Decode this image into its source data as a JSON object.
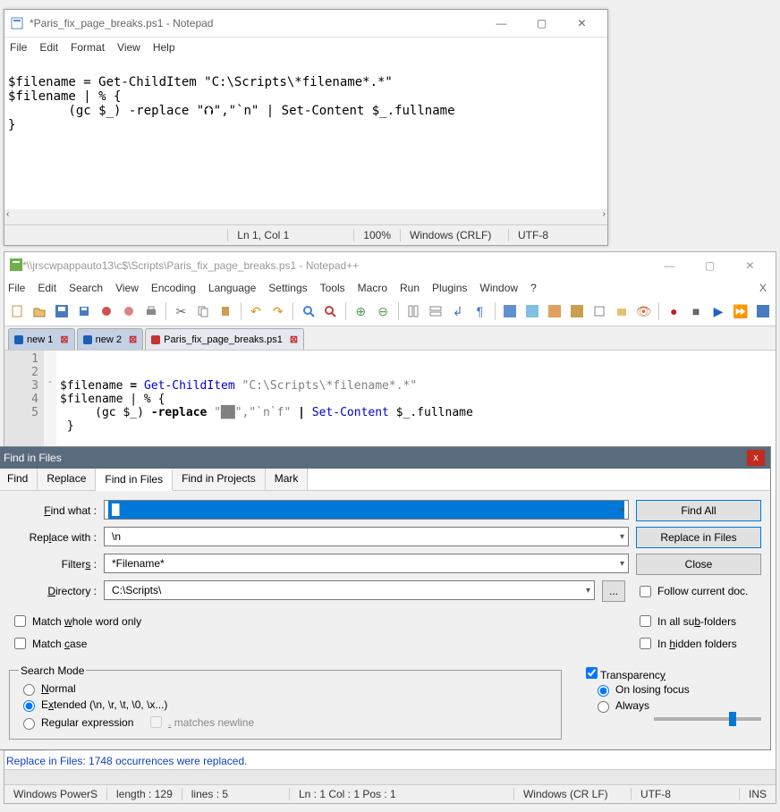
{
  "notepad": {
    "title": "*Paris_fix_page_breaks.ps1 - Notepad",
    "menu": [
      "File",
      "Edit",
      "Format",
      "View",
      "Help"
    ],
    "content": "\n$filename = Get-ChildItem \"C:\\Scripts\\*filename*.*\"\n$filename | % {\n        (gc $_) -replace \"⮉\",\"`n\" | Set-Content $_.fullname\n}",
    "status": {
      "lncol": "Ln 1, Col 1",
      "zoom": "100%",
      "eol": "Windows (CRLF)",
      "enc": "UTF-8"
    }
  },
  "npp": {
    "title": "*\\\\jrscwpappauto13\\c$\\Scripts\\Paris_fix_page_breaks.ps1 - Notepad++",
    "menu": [
      "File",
      "Edit",
      "Search",
      "View",
      "Encoding",
      "Language",
      "Settings",
      "Tools",
      "Macro",
      "Run",
      "Plugins",
      "Window",
      "?"
    ],
    "tabs": [
      {
        "label": "new 1",
        "modified": false
      },
      {
        "label": "new 2",
        "modified": false
      },
      {
        "label": "Paris_fix_page_breaks.ps1",
        "modified": true
      }
    ],
    "gutter": "1\n2\n3\n4\n5",
    "fold": " \n \n-\n \n ",
    "code": {
      "l1": "",
      "l2_pre": "$filename ",
      "l2_eq": "= ",
      "l2_cmd": "Get-ChildItem",
      "l2_str": " \"C:\\Scripts\\*filename*.*\"",
      "l3": "$filename | % {",
      "l4_pre": "     (gc $_) ",
      "l4_op": "-replace ",
      "l4_str": "\"██\",\"`n`f\"",
      "l4_pipe": " | ",
      "l4_cmd": "Set-Content",
      "l4_tail": " $_.fullname",
      "l5": " }"
    },
    "msg": "Replace in Files: 1748 occurrences were replaced.",
    "status": {
      "lang": "Windows PowerS",
      "length": "length : 129",
      "lines": "lines : 5",
      "lncolpos": "Ln : 1    Col : 1    Pos : 1",
      "eol": "Windows (CR LF)",
      "enc": "UTF-8",
      "ovr": "INS"
    }
  },
  "find": {
    "title": "Find in Files",
    "tabs": [
      "Find",
      "Replace",
      "Find in Files",
      "Find in Projects",
      "Mark"
    ],
    "active_tab": "Find in Files",
    "labels": {
      "find_what": "Find what :",
      "replace_with": "Replace with :",
      "filters": "Filters :",
      "directory": "Directory :"
    },
    "values": {
      "find_what": "█",
      "replace_with": "\\n",
      "filters": "*Filename*",
      "directory": "C:\\Scripts\\"
    },
    "buttons": {
      "find_all": "Find All",
      "replace_in_files": "Replace in Files",
      "close": "Close",
      "browse": "..."
    },
    "checks": {
      "follow": "Follow current doc.",
      "subfolders": "In all sub-folders",
      "hidden": "In hidden folders",
      "whole_word": "Match whole word only",
      "match_case": "Match case",
      "transparency": "Transparency",
      "on_losing": "On losing focus",
      "always": "Always"
    },
    "search_mode": {
      "legend": "Search Mode",
      "normal": "Normal",
      "extended": "Extended (\\n, \\r, \\t, \\0, \\x...)",
      "regex": "Regular expression",
      "dot_nl": ". matches newline"
    }
  }
}
